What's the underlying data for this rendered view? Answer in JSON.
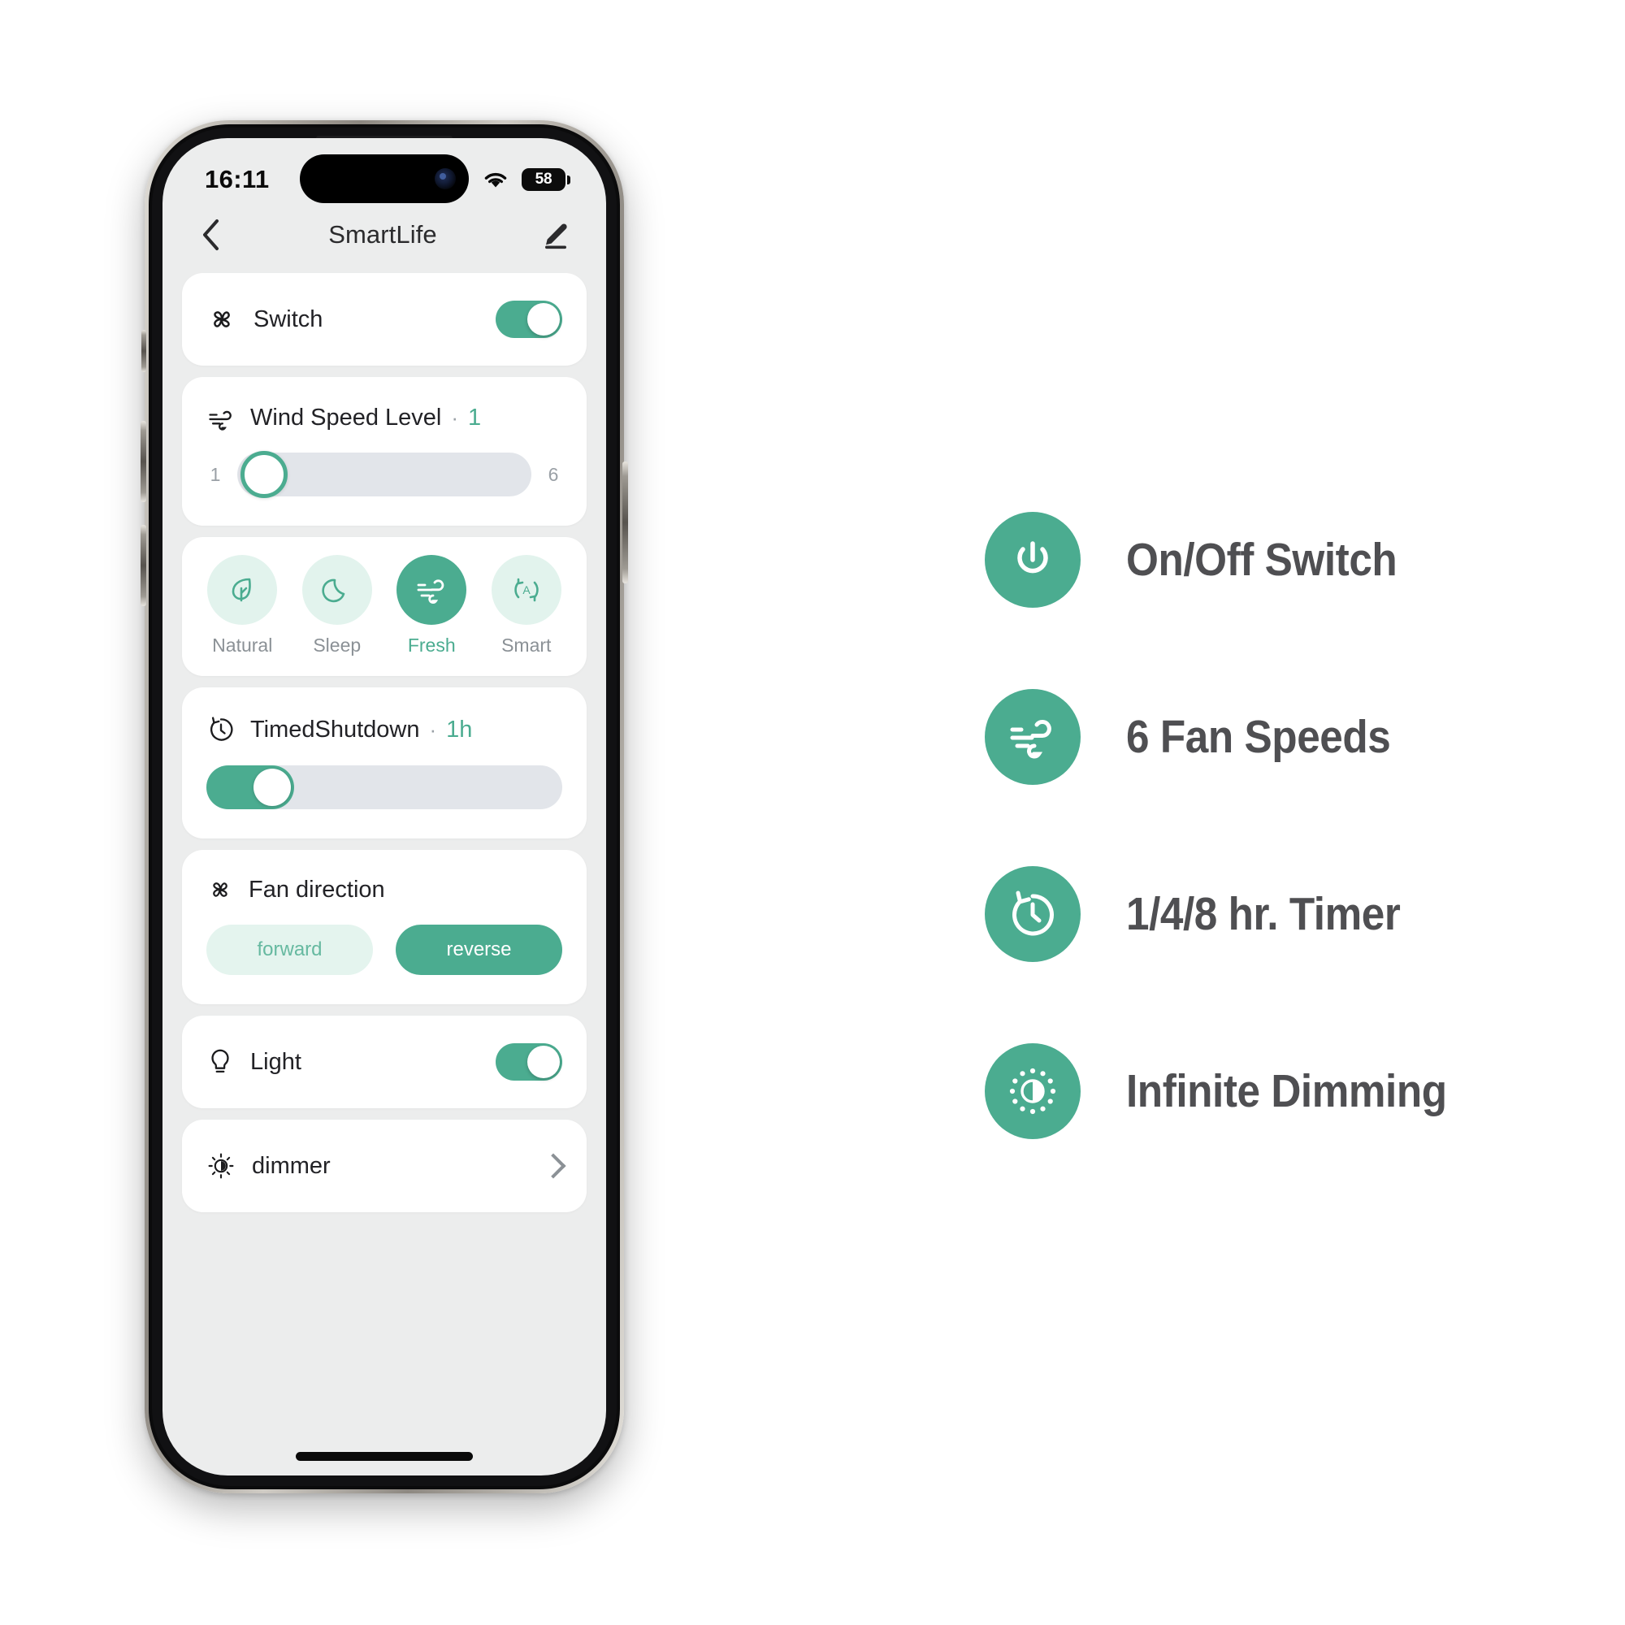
{
  "phone": {
    "status_bar": {
      "time": "16:11",
      "cellular_icon": "signal-bars-icon",
      "wifi_icon": "wifi-icon",
      "battery_icon": "battery-icon",
      "battery_level": "58"
    },
    "nav": {
      "back_icon": "chevron-left-icon",
      "title": "SmartLife",
      "edit_icon": "pencil-edit-icon"
    },
    "switch_card": {
      "icon": "fan-icon",
      "label": "Switch",
      "toggle_state": "on"
    },
    "wind_speed_card": {
      "icon": "wind-icon",
      "title": "Wind Speed Level",
      "separator": "·",
      "value": "1",
      "slider_min": "1",
      "slider_max": "6"
    },
    "modes": [
      {
        "label": "Natural",
        "icon": "leaf-icon",
        "active": false
      },
      {
        "label": "Sleep",
        "icon": "moon-icon",
        "active": false
      },
      {
        "label": "Fresh",
        "icon": "wind-icon",
        "active": true
      },
      {
        "label": "Smart",
        "icon": "auto-refresh-icon",
        "active": false
      }
    ],
    "timer_card": {
      "icon": "clock-timer-icon",
      "title": "TimedShutdown",
      "separator": "·",
      "value": "1h"
    },
    "fan_direction_card": {
      "icon": "fan-icon",
      "title": "Fan  direction",
      "options": [
        {
          "label": "forward",
          "selected": false
        },
        {
          "label": "reverse",
          "selected": true
        }
      ]
    },
    "light_card": {
      "icon": "bulb-icon",
      "label": "Light",
      "toggle_state": "on"
    },
    "dimmer_card": {
      "icon": "brightness-icon",
      "label": "dimmer",
      "chevron_icon": "chevron-right-icon"
    }
  },
  "features": [
    {
      "label": "On/Off Switch",
      "icon": "power-icon"
    },
    {
      "label": "6 Fan Speeds",
      "icon": "wind-icon"
    },
    {
      "label": "1/4/8 hr. Timer",
      "icon": "clock-timer-icon"
    },
    {
      "label": "Infinite Dimming",
      "icon": "brightness-dim-icon"
    }
  ],
  "colors": {
    "accent": "#4BAC90",
    "accent_light": "#e2f3ed",
    "screen_bg": "#eceded",
    "card_bg": "#ffffff",
    "track": "#e2e5ea",
    "text_dark": "#222226",
    "text_muted": "#8b9196",
    "feature_text": "#4f4f52"
  }
}
